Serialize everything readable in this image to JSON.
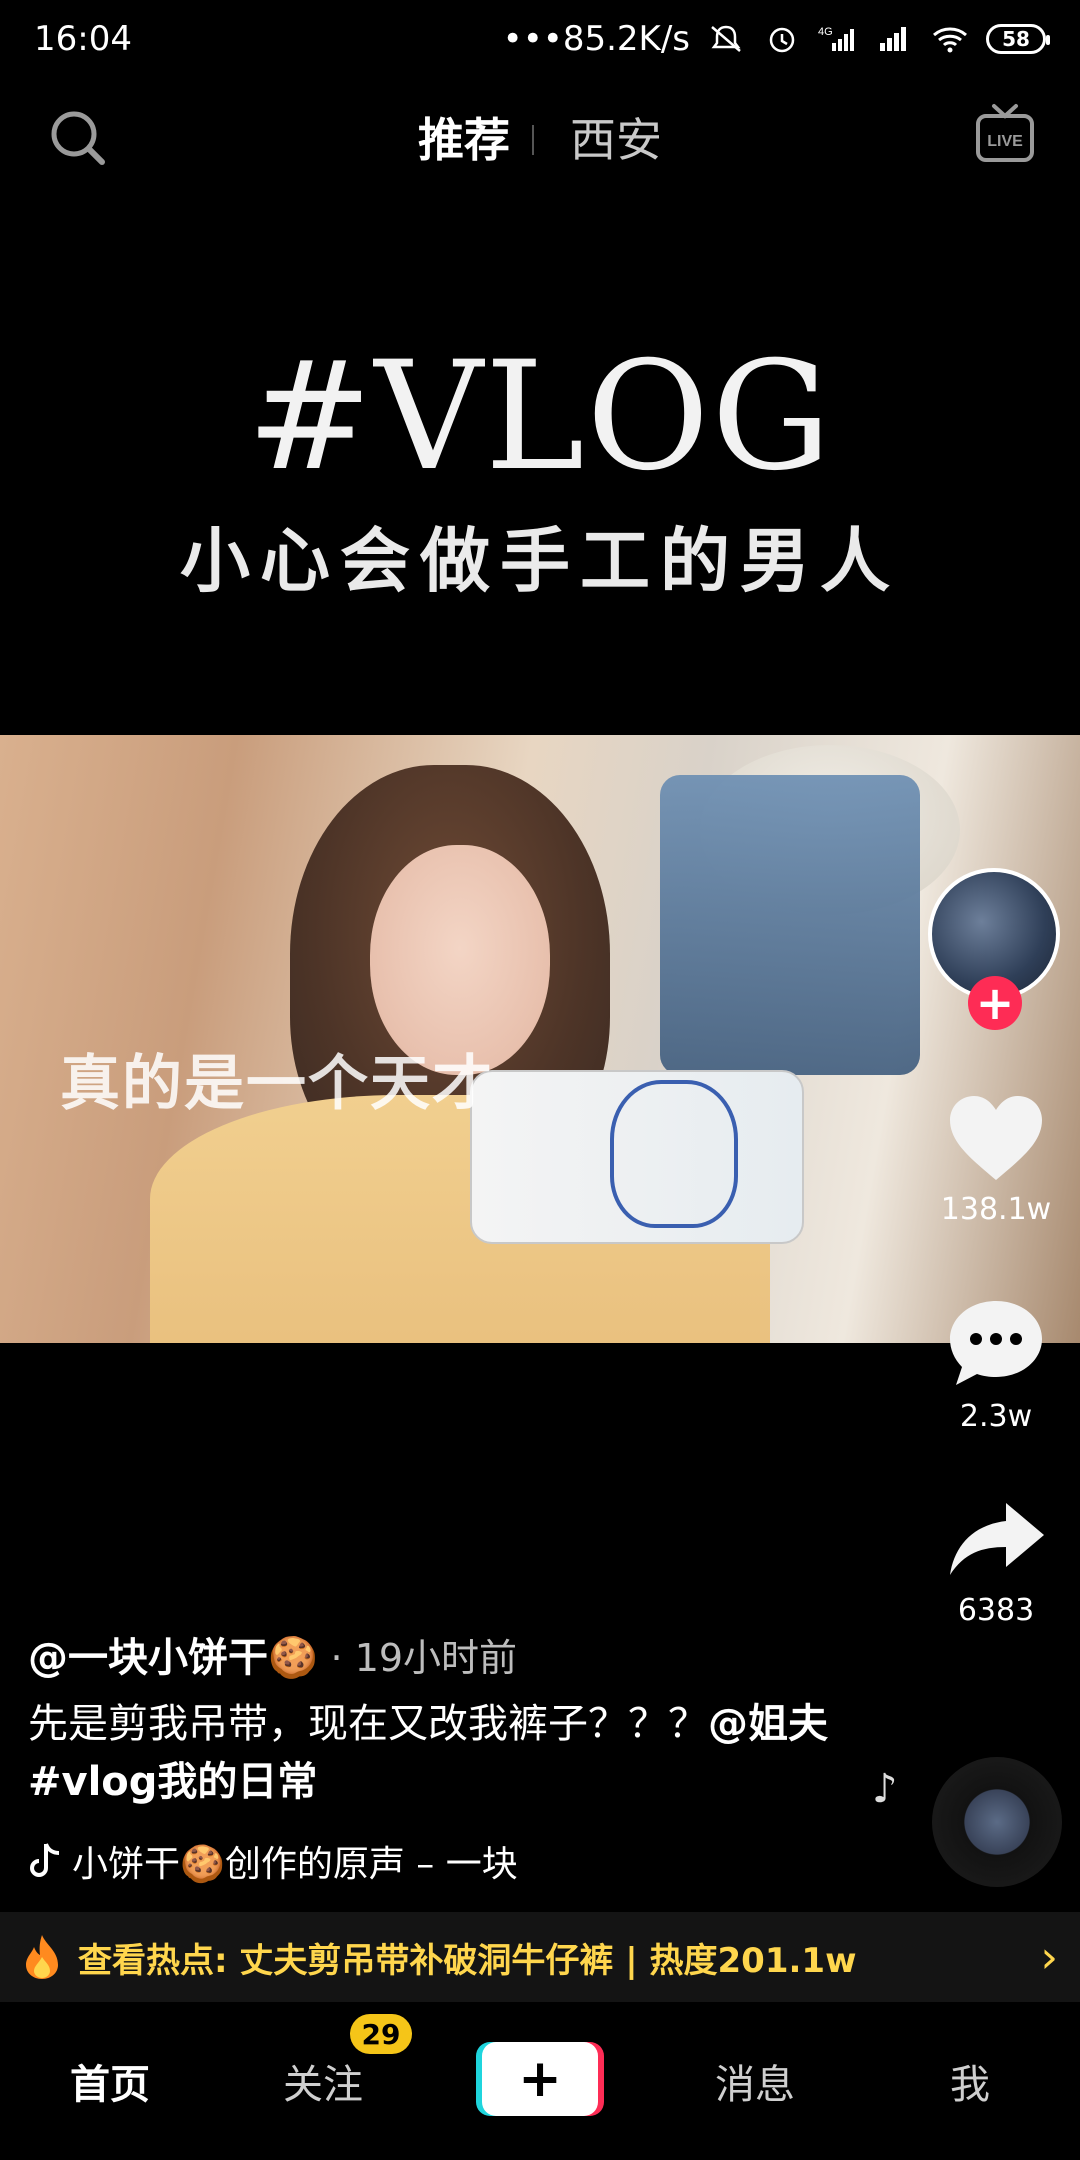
{
  "status_bar": {
    "time": "16:04",
    "network_speed": "•••85.2K/s",
    "battery_level": "58",
    "icons": [
      "mute-icon",
      "alarm-icon",
      "signal-4g-icon",
      "signal-icon",
      "wifi-icon"
    ]
  },
  "top_bar": {
    "tabs": [
      {
        "label": "推荐",
        "active": true
      },
      {
        "label": "西安",
        "active": false
      }
    ],
    "icons": [
      "search-icon",
      "live-icon"
    ]
  },
  "video": {
    "title": "#VLOG",
    "subtitle": "小心会做手工的男人",
    "overlay_caption": "真的是一个天才"
  },
  "actions": {
    "like_count": "138.1w",
    "comment_count": "2.3w",
    "share_count": "6383",
    "icons": [
      "avatar",
      "follow-plus-icon",
      "heart-icon",
      "comment-icon",
      "share-icon"
    ]
  },
  "post": {
    "author": "@一块小饼干🍪",
    "time_ago": "· 19小时前",
    "description_line1": "先是剪我吊带，现在又改我裤子？？？",
    "mention": "@姐夫",
    "description_line2": "#vlog我的日常",
    "music": "小饼干🍪创作的原声 – 一块"
  },
  "hot_bar": {
    "text": "查看热点: 丈夫剪吊带补破洞牛仔裤 | 热度201.1w"
  },
  "bottom_nav": {
    "items": [
      "首页",
      "关注",
      "消息",
      "我"
    ],
    "follow_badge": "29"
  },
  "colors": {
    "accent_red": "#fe2c55",
    "accent_cyan": "#1fd5dd",
    "hot_yellow": "#ffd64d",
    "badge_yellow": "#f5c518"
  }
}
